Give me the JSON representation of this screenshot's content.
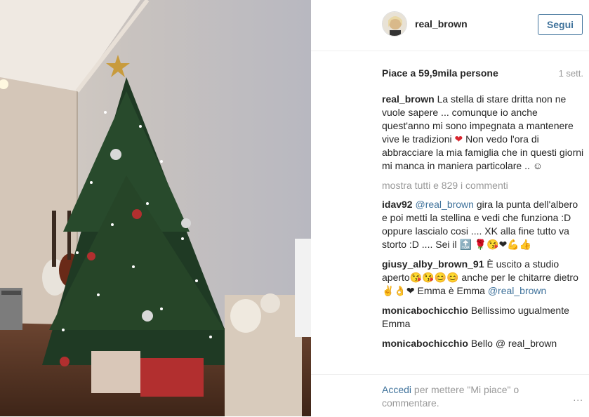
{
  "header": {
    "username": "real_brown",
    "follow_label": "Segui"
  },
  "stats": {
    "likes": "Piace a 59,9mila persone",
    "time": "1 sett."
  },
  "caption": {
    "user": "real_brown",
    "text_part1": "La stella di stare dritta non ne vuole sapere ... comunque io anche quest'anno mi sono impegnata a mantenere vive le tradizioni",
    "heart": "❤",
    "text_part2": "Non vedo l'ora di abbracciare la mia famiglia che in questi giorni mi manca in maniera particolare .. ☺"
  },
  "show_all": "mostra tutti e 829 i commenti",
  "comments": [
    {
      "user": "idav92",
      "mention": "@real_brown",
      "text": "gira la punta dell'albero e poi metti la stellina e vedi che funziona :D oppure lascialo cosi .... XK alla fine tutto va storto :D .... Sei il 🔝 🌹😘❤💪👍"
    },
    {
      "user": "giusy_alby_brown_91",
      "text": "È uscito a studio aperto😘😘😊😊 anche per le chitarre dietro ✌👌❤ Emma è Emma",
      "mention": "@real_brown"
    },
    {
      "user": "monicabochicchio",
      "text": "Bellissimo ugualmente Emma"
    },
    {
      "user": "monicabochicchio",
      "text": "Bello @ real_brown"
    }
  ],
  "footer": {
    "login_link": "Accedi",
    "login_text": "per mettere \"Mi piace\" o commentare.",
    "more": "..."
  },
  "icons": {
    "avatar": "user-avatar",
    "more": "more-options-icon"
  },
  "colors": {
    "link": "#3f729b",
    "muted": "#999999",
    "text": "#262626"
  }
}
